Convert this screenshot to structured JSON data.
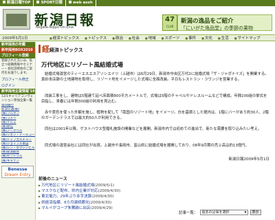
{
  "topnav": [
    "新潟日報TOP",
    "SPORT日報",
    "web assh"
  ],
  "logo": {
    "title": "新潟日報",
    "subtitle": "Niigata-Nippo On-Line"
  },
  "ads": {
    "badge_number": "47",
    "badge_caption": "CLUB",
    "banner_title": "新潟の逸品をご紹介",
    "banner_sub": "「にいがた逸品堂」の季節の果物"
  },
  "datebar": {
    "date": "2009年5月1日",
    "items": [
      "経済トピックス",
      "トピックス",
      "政治",
      "社会",
      "地域",
      "スポーツ",
      "事件",
      "文化",
      "生活",
      "サイトマップ"
    ]
  },
  "sidebar": {
    "sec1": "新卒採用の年鑑",
    "sec1_banner": "新卒採用BOX2010",
    "profile_hd": "プロフィール登録",
    "profile_txt": "登録された方には、役立つ就職情報やセミナー・会社説明会のご案内をお送りします。",
    "profile_link": "プロフィール修正",
    "login_link": "ログイン",
    "convention_hd": "新卒採用企業情報'10",
    "convention_txt": "12/1キャリアコンヴェンション参加企業一覧",
    "companies": [
      "第四銀行",
      "新潟交通(株)",
      "(株)ブルボン",
      "(株)コメリ",
      "(株)ナルス",
      "(株)原信",
      "(株)アークベル",
      "(株)リオン・ドールコーポレーション",
      "(株)トップカルチャー",
      "(株)ジョイフル本田",
      "(株)シン・ホクシンビル",
      "(株)新潟総合",
      "(株)セントラル",
      "(株)キタデン"
    ],
    "benesse_1": "Benesse",
    "benesse_2": "Dream Entry"
  },
  "main": {
    "topics_label": "経済トピックス",
    "topics_prefix": "経",
    "title": "万代地区にリゾート風結婚式場",
    "paragraphs": [
      "結婚式場運営のティーエスエスアソシエイツ（上越市）は6月29日、新潟市中央区万代2に結婚式場「ザ・ジャポナイズ」を開業する。真砂本店跡の土地建物を取得し、リゾート地をイメージした式場に全面改装。平日もレストラン・ラウンジを営業する。",
      "改装工事をし、建物は5階建て延べ床面積800平方メートルで、式場は5階のチャペルやドレスルームなどで構成。年間200組の挙式を目指し、来春には年間300組の利用を見込む。",
      "赤や黄色を使った外観を施し、植物を配して「南国のリゾート地」をイメージ。白を基調とした館内は、1階にバーがあり約30人、2階のガーデンテラスでは最大約50人が利用できる。",
      "同社は2001年以降、ゲストハウス型婚礼施設の開業などを展開。新潟市内では初めての進出で、新たな需要を取り込みたい考え。",
      "同式場の運営会社には同社が出資。上越市や長岡市、富山県に結婚式場を展開しており、08年9月期の売上高は約13億円。"
    ],
    "credit": "新潟日報2009年5月1日",
    "related_hd": "前後のニュース",
    "related": [
      {
        "text": "万代地区にリゾート風結婚式場",
        "date": "(2009/5/1)"
      },
      {
        "text": "マスクなど配布、県内企業が対応",
        "date": "(2009/4/30)"
      },
      {
        "text": "東北電力、29年ぶり赤字決算",
        "date": "(2009/4/30)"
      },
      {
        "text": "県経済指標、8カ月連続悪化",
        "date": "(2009/4/30)"
      },
      {
        "text": "マルイがコープ朱鷺跡に出店",
        "date": "(2009/4/29)"
      }
    ],
    "search_label": "記事一覧：",
    "search_select": "過去の記事を選択",
    "search_button": "表示"
  }
}
